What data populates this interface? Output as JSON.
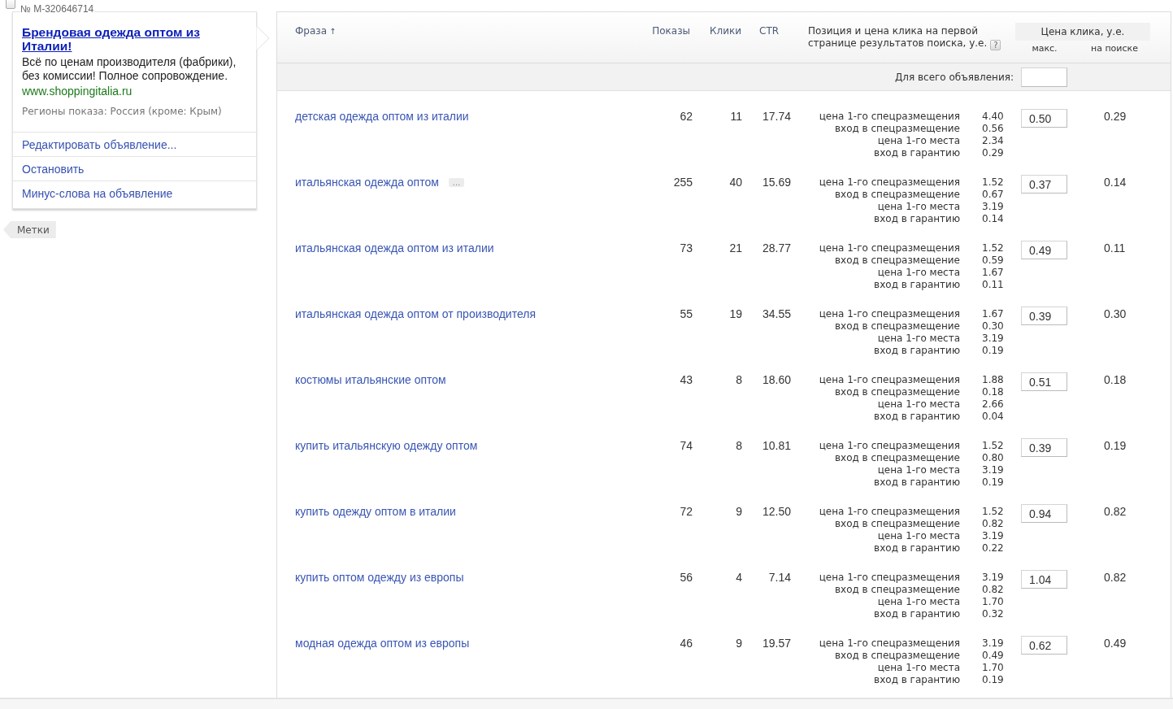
{
  "ad": {
    "checked": false,
    "number": "№ M-320646714",
    "title": "Брендовая одежда оптом из Италии!",
    "text": "Всё по ценам производителя (фабрики), без комиссии! Полное сопровождение.",
    "url": "www.shoppingitalia.ru",
    "regions": "Регионы показа: Россия (кроме: Крым)",
    "actions": [
      "Редактировать объявление...",
      "Остановить",
      "Минус-слова на объявление"
    ]
  },
  "tags_button": "Метки",
  "table": {
    "columns": [
      {
        "kind": "phrase",
        "label": "Фраза",
        "sort_arrow": "↑"
      },
      {
        "kind": "number",
        "label": "Показы"
      },
      {
        "kind": "number",
        "label": "Клики"
      },
      {
        "kind": "number",
        "label": "CTR"
      },
      {
        "kind": "position",
        "label": "Позиция и цена клика на первой странице результатов поиска, у.е.",
        "help": "?"
      }
    ],
    "price_group": {
      "label": "Цена клика, у.е.",
      "columns": [
        "макс.",
        "на поиске"
      ]
    },
    "all_ad": {
      "label": "Для всего объявления:"
    },
    "rows": [
      {
        "phrase": "детская одежда оптом из италии",
        "impressions": "62",
        "clicks": "11",
        "ctr": "17.74",
        "positions": [
          {
            "label": "цена 1-го спецразмещения",
            "value": "4.40"
          },
          {
            "label": "вход в спецразмещение",
            "value": "0.56"
          },
          {
            "label": "цена 1-го места",
            "value": "2.34"
          },
          {
            "label": "вход в гарантию",
            "value": "0.29"
          }
        ],
        "max_bid": "0.50",
        "search_price": "0.29"
      },
      {
        "phrase": "итальянская одежда оптом",
        "more_button": "...",
        "impressions": "255",
        "clicks": "40",
        "ctr": "15.69",
        "positions": [
          {
            "label": "цена 1-го спецразмещения",
            "value": "1.52"
          },
          {
            "label": "вход в спецразмещение",
            "value": "0.67"
          },
          {
            "label": "цена 1-го места",
            "value": "3.19"
          },
          {
            "label": "вход в гарантию",
            "value": "0.14"
          }
        ],
        "max_bid": "0.37",
        "search_price": "0.14"
      },
      {
        "phrase": "итальянская одежда оптом из италии",
        "impressions": "73",
        "clicks": "21",
        "ctr": "28.77",
        "positions": [
          {
            "label": "цена 1-го спецразмещения",
            "value": "1.52"
          },
          {
            "label": "вход в спецразмещение",
            "value": "0.59"
          },
          {
            "label": "цена 1-го места",
            "value": "1.67"
          },
          {
            "label": "вход в гарантию",
            "value": "0.11"
          }
        ],
        "max_bid": "0.49",
        "search_price": "0.11"
      },
      {
        "phrase": "итальянская одежда оптом от производителя",
        "impressions": "55",
        "clicks": "19",
        "ctr": "34.55",
        "positions": [
          {
            "label": "цена 1-го спецразмещения",
            "value": "1.67"
          },
          {
            "label": "вход в спецразмещение",
            "value": "0.30"
          },
          {
            "label": "цена 1-го места",
            "value": "3.19"
          },
          {
            "label": "вход в гарантию",
            "value": "0.19"
          }
        ],
        "max_bid": "0.39",
        "search_price": "0.30"
      },
      {
        "phrase": "костюмы итальянские оптом",
        "impressions": "43",
        "clicks": "8",
        "ctr": "18.60",
        "positions": [
          {
            "label": "цена 1-го спецразмещения",
            "value": "1.88"
          },
          {
            "label": "вход в спецразмещение",
            "value": "0.18"
          },
          {
            "label": "цена 1-го места",
            "value": "2.66"
          },
          {
            "label": "вход в гарантию",
            "value": "0.04"
          }
        ],
        "max_bid": "0.51",
        "search_price": "0.18"
      },
      {
        "phrase": "купить итальянскую одежду оптом",
        "impressions": "74",
        "clicks": "8",
        "ctr": "10.81",
        "positions": [
          {
            "label": "цена 1-го спецразмещения",
            "value": "1.52"
          },
          {
            "label": "вход в спецразмещение",
            "value": "0.80"
          },
          {
            "label": "цена 1-го места",
            "value": "3.19"
          },
          {
            "label": "вход в гарантию",
            "value": "0.19"
          }
        ],
        "max_bid": "0.39",
        "search_price": "0.19"
      },
      {
        "phrase": "купить одежду оптом в италии",
        "impressions": "72",
        "clicks": "9",
        "ctr": "12.50",
        "positions": [
          {
            "label": "цена 1-го спецразмещения",
            "value": "1.52"
          },
          {
            "label": "вход в спецразмещение",
            "value": "0.82"
          },
          {
            "label": "цена 1-го места",
            "value": "3.19"
          },
          {
            "label": "вход в гарантию",
            "value": "0.22"
          }
        ],
        "max_bid": "0.94",
        "search_price": "0.82"
      },
      {
        "phrase": "купить оптом одежду из европы",
        "impressions": "56",
        "clicks": "4",
        "ctr": "7.14",
        "positions": [
          {
            "label": "цена 1-го спецразмещения",
            "value": "3.19"
          },
          {
            "label": "вход в спецразмещение",
            "value": "0.82"
          },
          {
            "label": "цена 1-го места",
            "value": "1.70"
          },
          {
            "label": "вход в гарантию",
            "value": "0.32"
          }
        ],
        "max_bid": "1.04",
        "search_price": "0.82"
      },
      {
        "phrase": "модная одежда оптом из европы",
        "impressions": "46",
        "clicks": "9",
        "ctr": "19.57",
        "positions": [
          {
            "label": "цена 1-го спецразмещения",
            "value": "3.19"
          },
          {
            "label": "вход в спецразмещение",
            "value": "0.49"
          },
          {
            "label": "цена 1-го места",
            "value": "1.70"
          },
          {
            "label": "вход в гарантию",
            "value": "0.19"
          }
        ],
        "max_bid": "0.62",
        "search_price": "0.49"
      }
    ]
  }
}
